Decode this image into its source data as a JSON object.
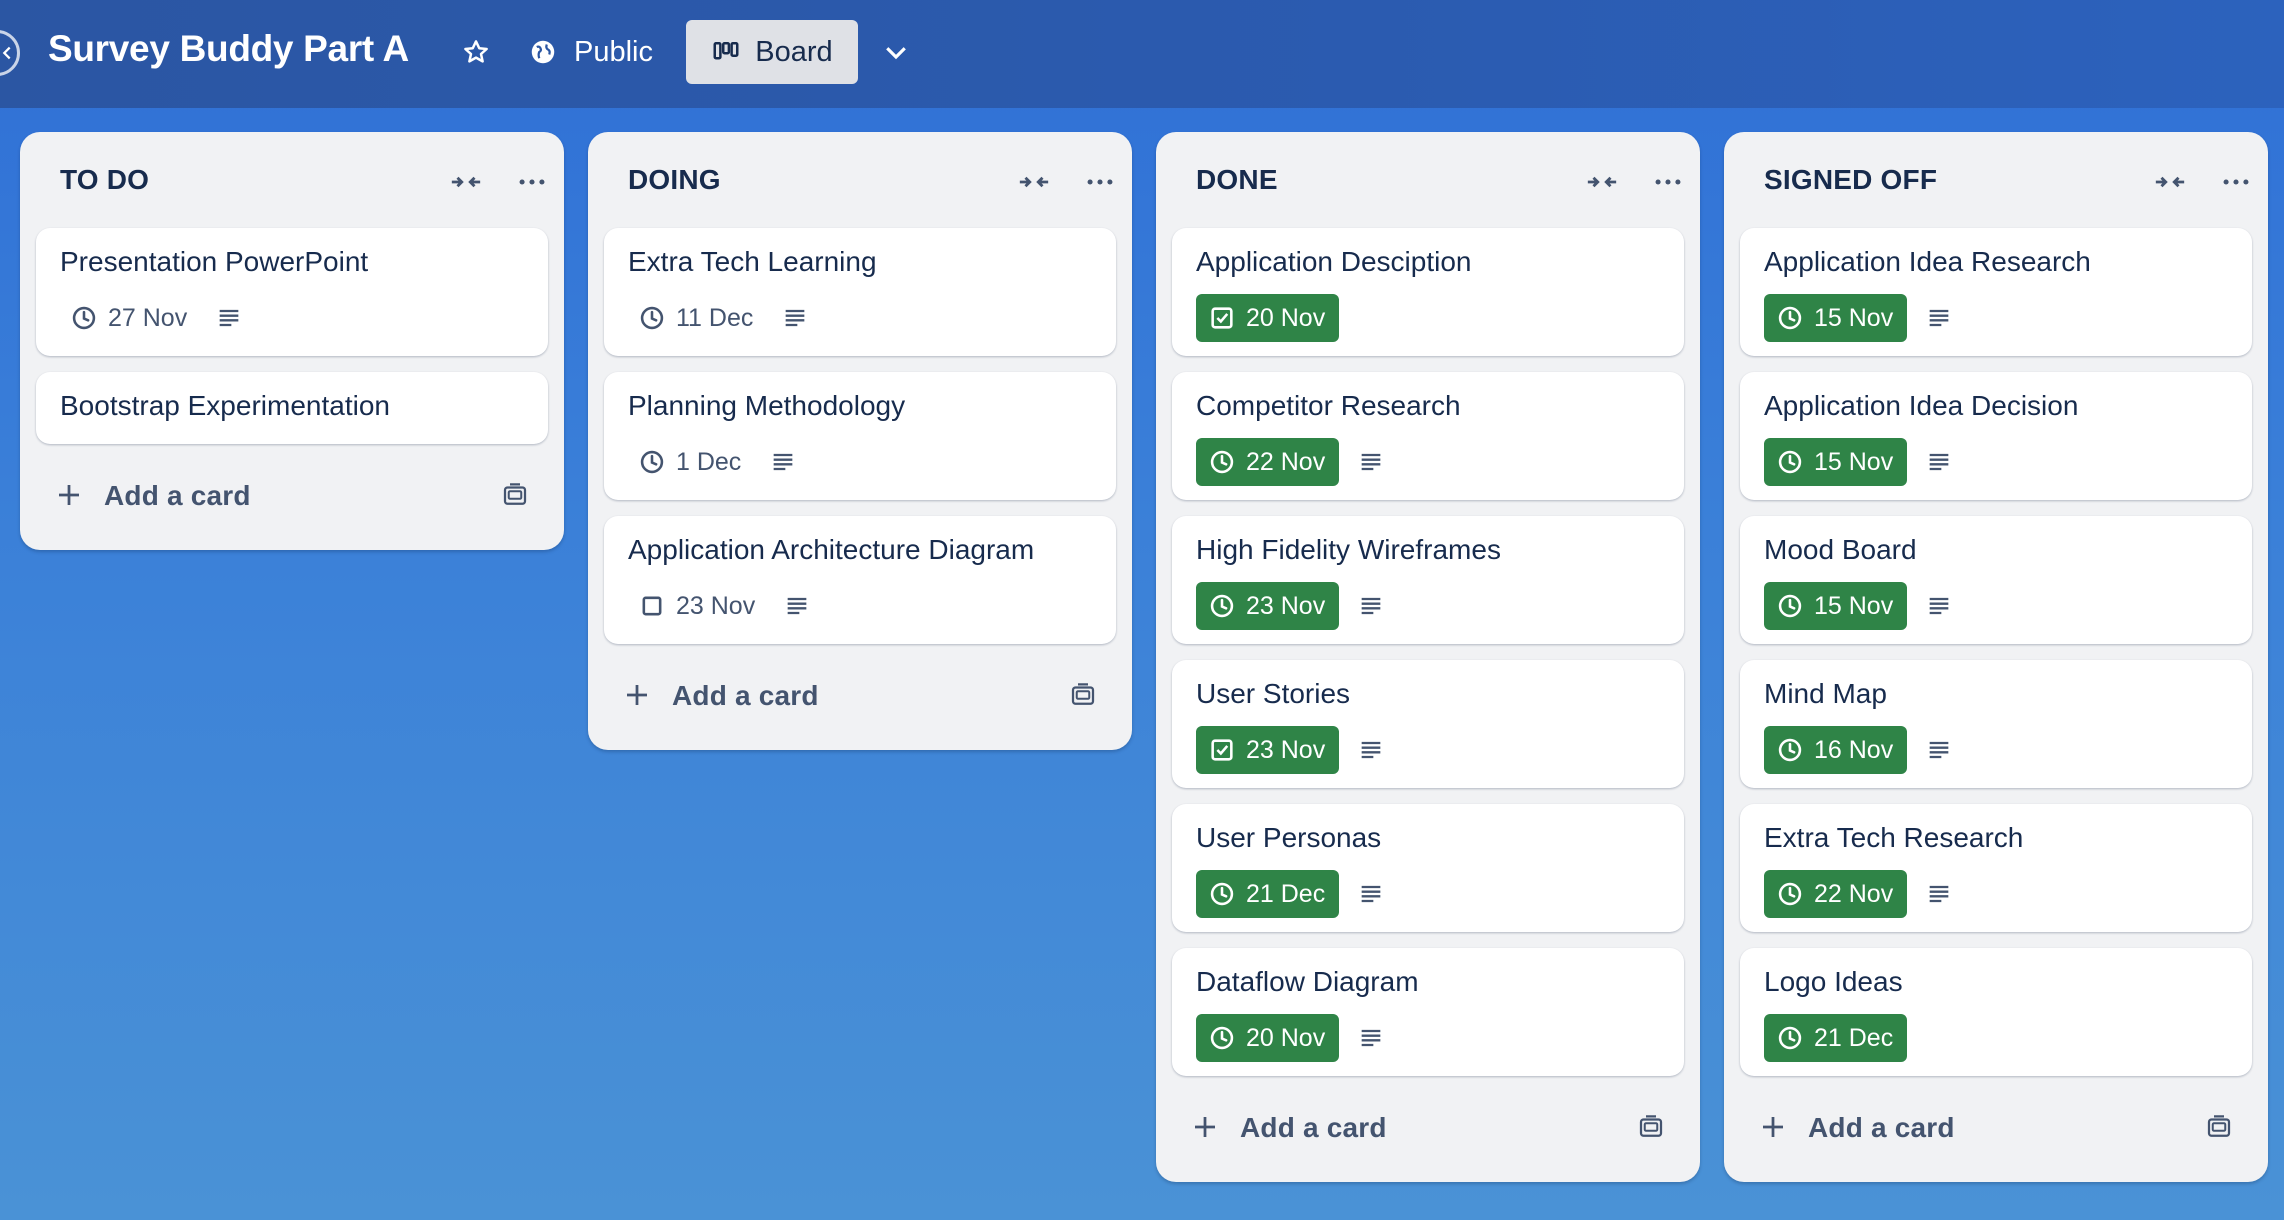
{
  "header": {
    "board_title": "Survey Buddy Part A",
    "visibility_label": "Public",
    "view_label": "Board"
  },
  "colors": {
    "due_complete_badge": "#2f8447",
    "list_bg": "#f1f2f4",
    "header_bg": "#2b56a3"
  },
  "lists": [
    {
      "title": "TO DO",
      "add_card_label": "Add a card",
      "cards": [
        {
          "title": "Presentation PowerPoint",
          "date": "27 Nov",
          "date_icon": "clock-icon",
          "complete": false,
          "has_description": true
        },
        {
          "title": "Bootstrap Experimentation"
        }
      ]
    },
    {
      "title": "DOING",
      "add_card_label": "Add a card",
      "cards": [
        {
          "title": "Extra Tech Learning",
          "date": "11 Dec",
          "date_icon": "clock-icon",
          "complete": false,
          "has_description": true
        },
        {
          "title": "Planning Methodology",
          "date": "1 Dec",
          "date_icon": "clock-icon",
          "complete": false,
          "has_description": true
        },
        {
          "title": "Application Architecture Diagram",
          "date": "23 Nov",
          "date_icon": "checkbox-empty-icon",
          "complete": false,
          "has_description": true
        }
      ]
    },
    {
      "title": "DONE",
      "add_card_label": "Add a card",
      "cards": [
        {
          "title": "Application Desciption",
          "date": "20 Nov",
          "date_icon": "checkbox-checked-icon",
          "complete": true,
          "has_description": false
        },
        {
          "title": "Competitor Research",
          "date": "22 Nov",
          "date_icon": "clock-icon",
          "complete": true,
          "has_description": true
        },
        {
          "title": "High Fidelity Wireframes",
          "date": "23 Nov",
          "date_icon": "clock-icon",
          "complete": true,
          "has_description": true
        },
        {
          "title": "User Stories",
          "date": "23 Nov",
          "date_icon": "checkbox-checked-icon",
          "complete": true,
          "has_description": true
        },
        {
          "title": "User Personas",
          "date": "21 Dec",
          "date_icon": "clock-icon",
          "complete": true,
          "has_description": true
        },
        {
          "title": "Dataflow Diagram",
          "date": "20 Nov",
          "date_icon": "clock-icon",
          "complete": true,
          "has_description": true
        }
      ]
    },
    {
      "title": "SIGNED OFF",
      "add_card_label": "Add a card",
      "cards": [
        {
          "title": "Application Idea Research",
          "date": "15 Nov",
          "date_icon": "clock-icon",
          "complete": true,
          "has_description": true
        },
        {
          "title": "Application Idea Decision",
          "date": "15 Nov",
          "date_icon": "clock-icon",
          "complete": true,
          "has_description": true
        },
        {
          "title": "Mood Board",
          "date": "15 Nov",
          "date_icon": "clock-icon",
          "complete": true,
          "has_description": true
        },
        {
          "title": "Mind Map",
          "date": "16 Nov",
          "date_icon": "clock-icon",
          "complete": true,
          "has_description": true
        },
        {
          "title": "Extra Tech Research",
          "date": "22 Nov",
          "date_icon": "clock-icon",
          "complete": true,
          "has_description": true
        },
        {
          "title": "Logo Ideas",
          "date": "21 Dec",
          "date_icon": "clock-icon",
          "complete": true,
          "has_description": false
        }
      ]
    }
  ]
}
